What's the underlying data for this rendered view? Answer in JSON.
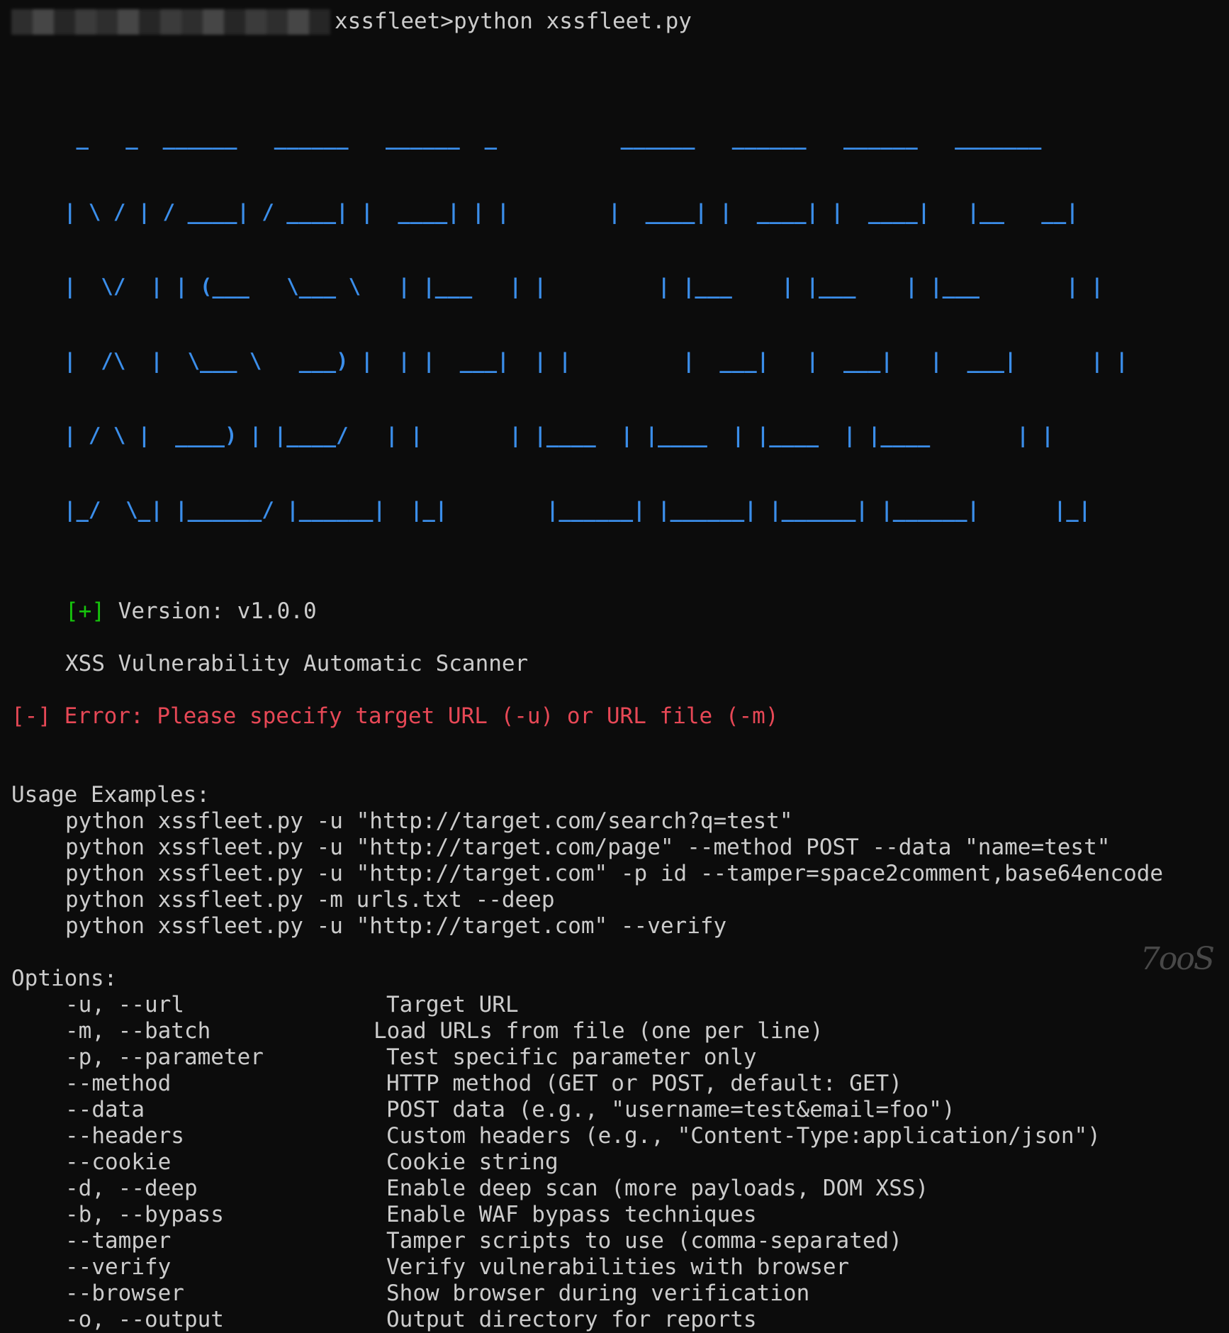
{
  "prompt": {
    "path_suffix": "xssfleet>",
    "command": "python xssfleet.py"
  },
  "banner_lines": [
    " _   _  ______   ______   ______  _          ______   ______   ______   _______",
    "| \\ / | / ____| / ____| |  ____| | |        |  ____| |  ____| |  ____|   |__   __|",
    "|  \\/  | | (___   \\___ \\   | |___   | |         | |___    | |___    | |___       | |",
    "|  /\\  |  \\___ \\   ___) |  | |  ___|  | |         |  ___|   |  ___|   |  ___|      | |",
    "| / \\ |  ____) | |____/   | |       | |____  | |____  | |____  | |____       | |",
    "|_/  \\_| |______/ |______|  |_|        |______| |______| |______| |______|      |_|"
  ],
  "version": {
    "marker": "[+]",
    "text": "Version: v1.0.0"
  },
  "subtitle": "XSS Vulnerability Automatic Scanner",
  "error": {
    "marker": "[-]",
    "text": "Error: Please specify target URL (-u) or URL file (-m)"
  },
  "usage": {
    "header": "Usage Examples:",
    "examples": [
      "python xssfleet.py -u \"http://target.com/search?q=test\"",
      "python xssfleet.py -u \"http://target.com/page\" --method POST --data \"name=test\"",
      "python xssfleet.py -u \"http://target.com\" -p id --tamper=space2comment,base64encode",
      "python xssfleet.py -m urls.txt --deep",
      "python xssfleet.py -u \"http://target.com\" --verify"
    ]
  },
  "options": {
    "header": "Options:",
    "rows": [
      {
        "flag": "-u, --url",
        "desc": "Target URL"
      },
      {
        "flag": "-m, --batch",
        "desc": "Load URLs from file (one per line)"
      },
      {
        "flag": "-p, --parameter",
        "desc": "Test specific parameter only"
      },
      {
        "flag": "--method",
        "desc": "HTTP method (GET or POST, default: GET)"
      },
      {
        "flag": "--data",
        "desc": "POST data (e.g., \"username=test&email=foo\")"
      },
      {
        "flag": "--headers",
        "desc": "Custom headers (e.g., \"Content-Type:application/json\")"
      },
      {
        "flag": "--cookie",
        "desc": "Cookie string"
      },
      {
        "flag": "-d, --deep",
        "desc": "Enable deep scan (more payloads, DOM XSS)"
      },
      {
        "flag": "-b, --bypass",
        "desc": "Enable WAF bypass techniques"
      },
      {
        "flag": "--tamper",
        "desc": "Tamper scripts to use (comma-separated)"
      },
      {
        "flag": "--verify",
        "desc": "Verify vulnerabilities with browser"
      },
      {
        "flag": "--browser",
        "desc": "Show browser during verification"
      },
      {
        "flag": "-o, --output",
        "desc": "Output directory for reports"
      }
    ]
  },
  "watermark": "7ooS",
  "colors": {
    "background": "#0c0c0c",
    "text": "#cccccc",
    "banner": "#3b8eea",
    "success": "#16c60c",
    "error": "#e74856"
  }
}
